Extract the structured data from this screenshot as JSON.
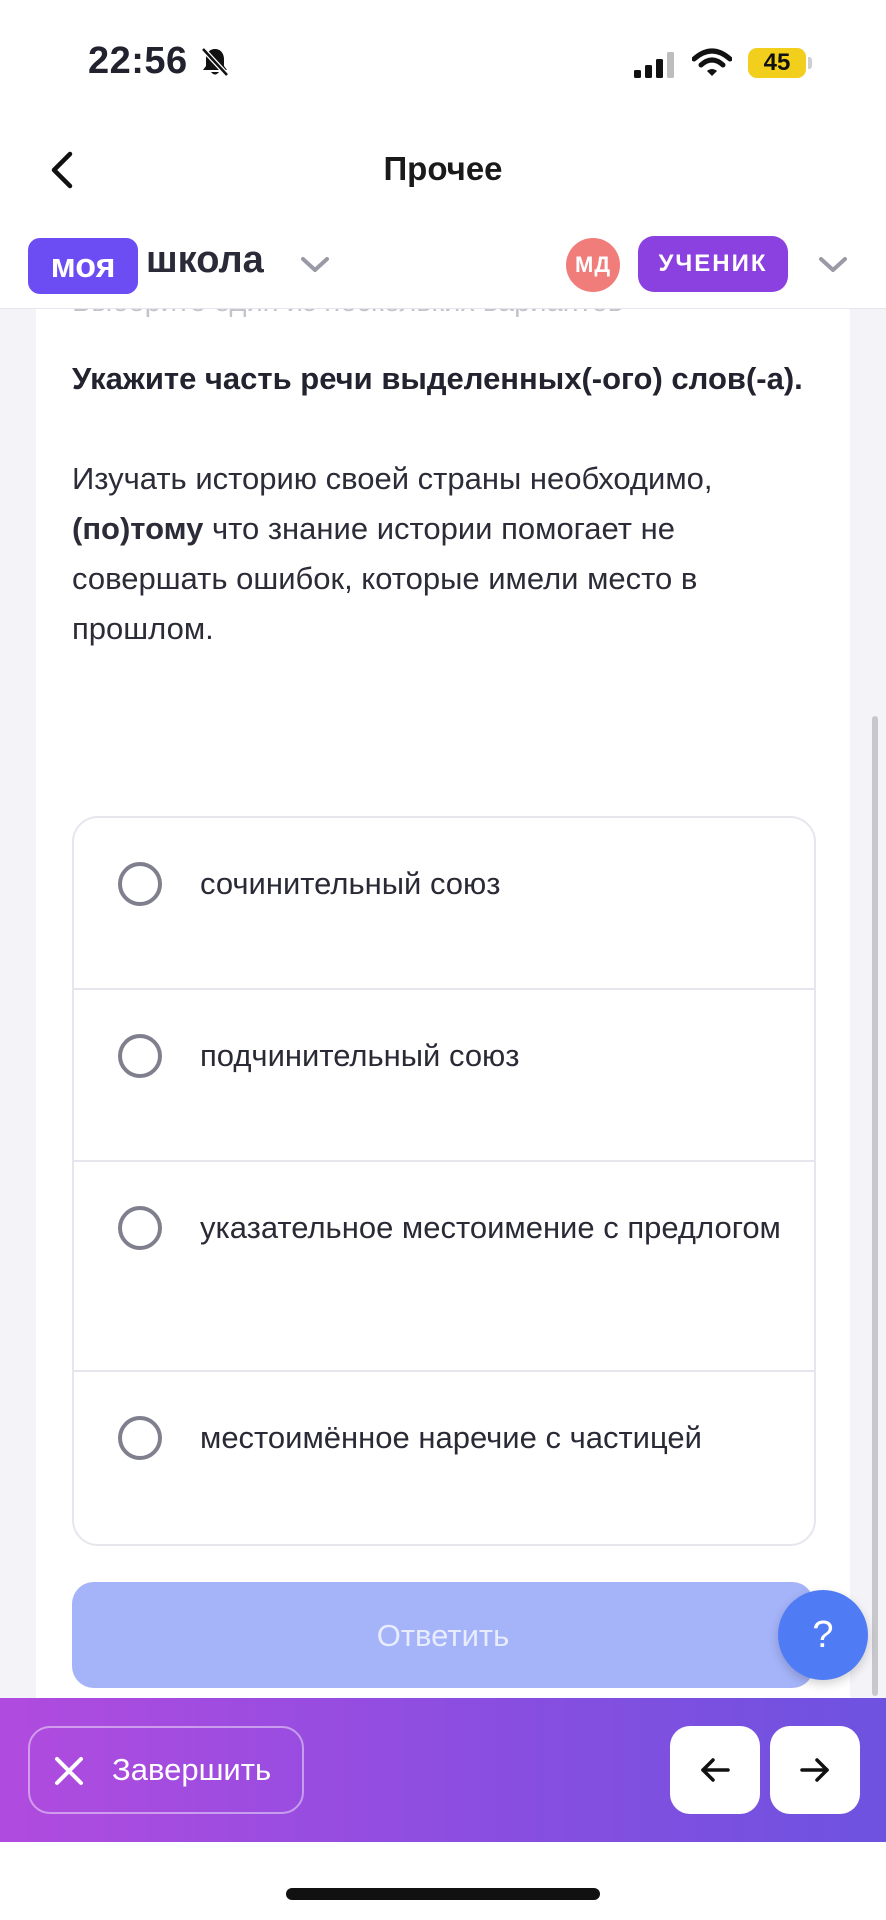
{
  "status_bar": {
    "time": "22:56",
    "battery": "45"
  },
  "nav": {
    "title": "Прочее"
  },
  "header": {
    "logo_part1": "моя",
    "logo_part2": "школа",
    "avatar_initials": "МД",
    "role_label": "УЧЕНИК"
  },
  "task": {
    "hint": "Выберите один из нескольких вариантов",
    "question": "Укажите часть речи выделенных(-ого) слов(-а).",
    "passage_before": "Изучать историю своей страны необходимо, ",
    "passage_highlight": "(по)тому",
    "passage_after": " что знание истории помогает не совершать ошибок, которые имели место в прошлом."
  },
  "options": [
    {
      "label": "сочинительный союз"
    },
    {
      "label": "подчинительный союз"
    },
    {
      "label": "указательное местоимение с предлогом"
    },
    {
      "label": "местоимённое наречие с частицей"
    }
  ],
  "answer_label": "Ответить",
  "help_label": "?",
  "bottom": {
    "finish_label": "Завершить"
  },
  "colors": {
    "brand": "#6c4cf3",
    "role": "#8a41df",
    "avatar": "#f07d7a",
    "answer_disabled": "#a5b3f9",
    "help": "#4f7cf5"
  }
}
